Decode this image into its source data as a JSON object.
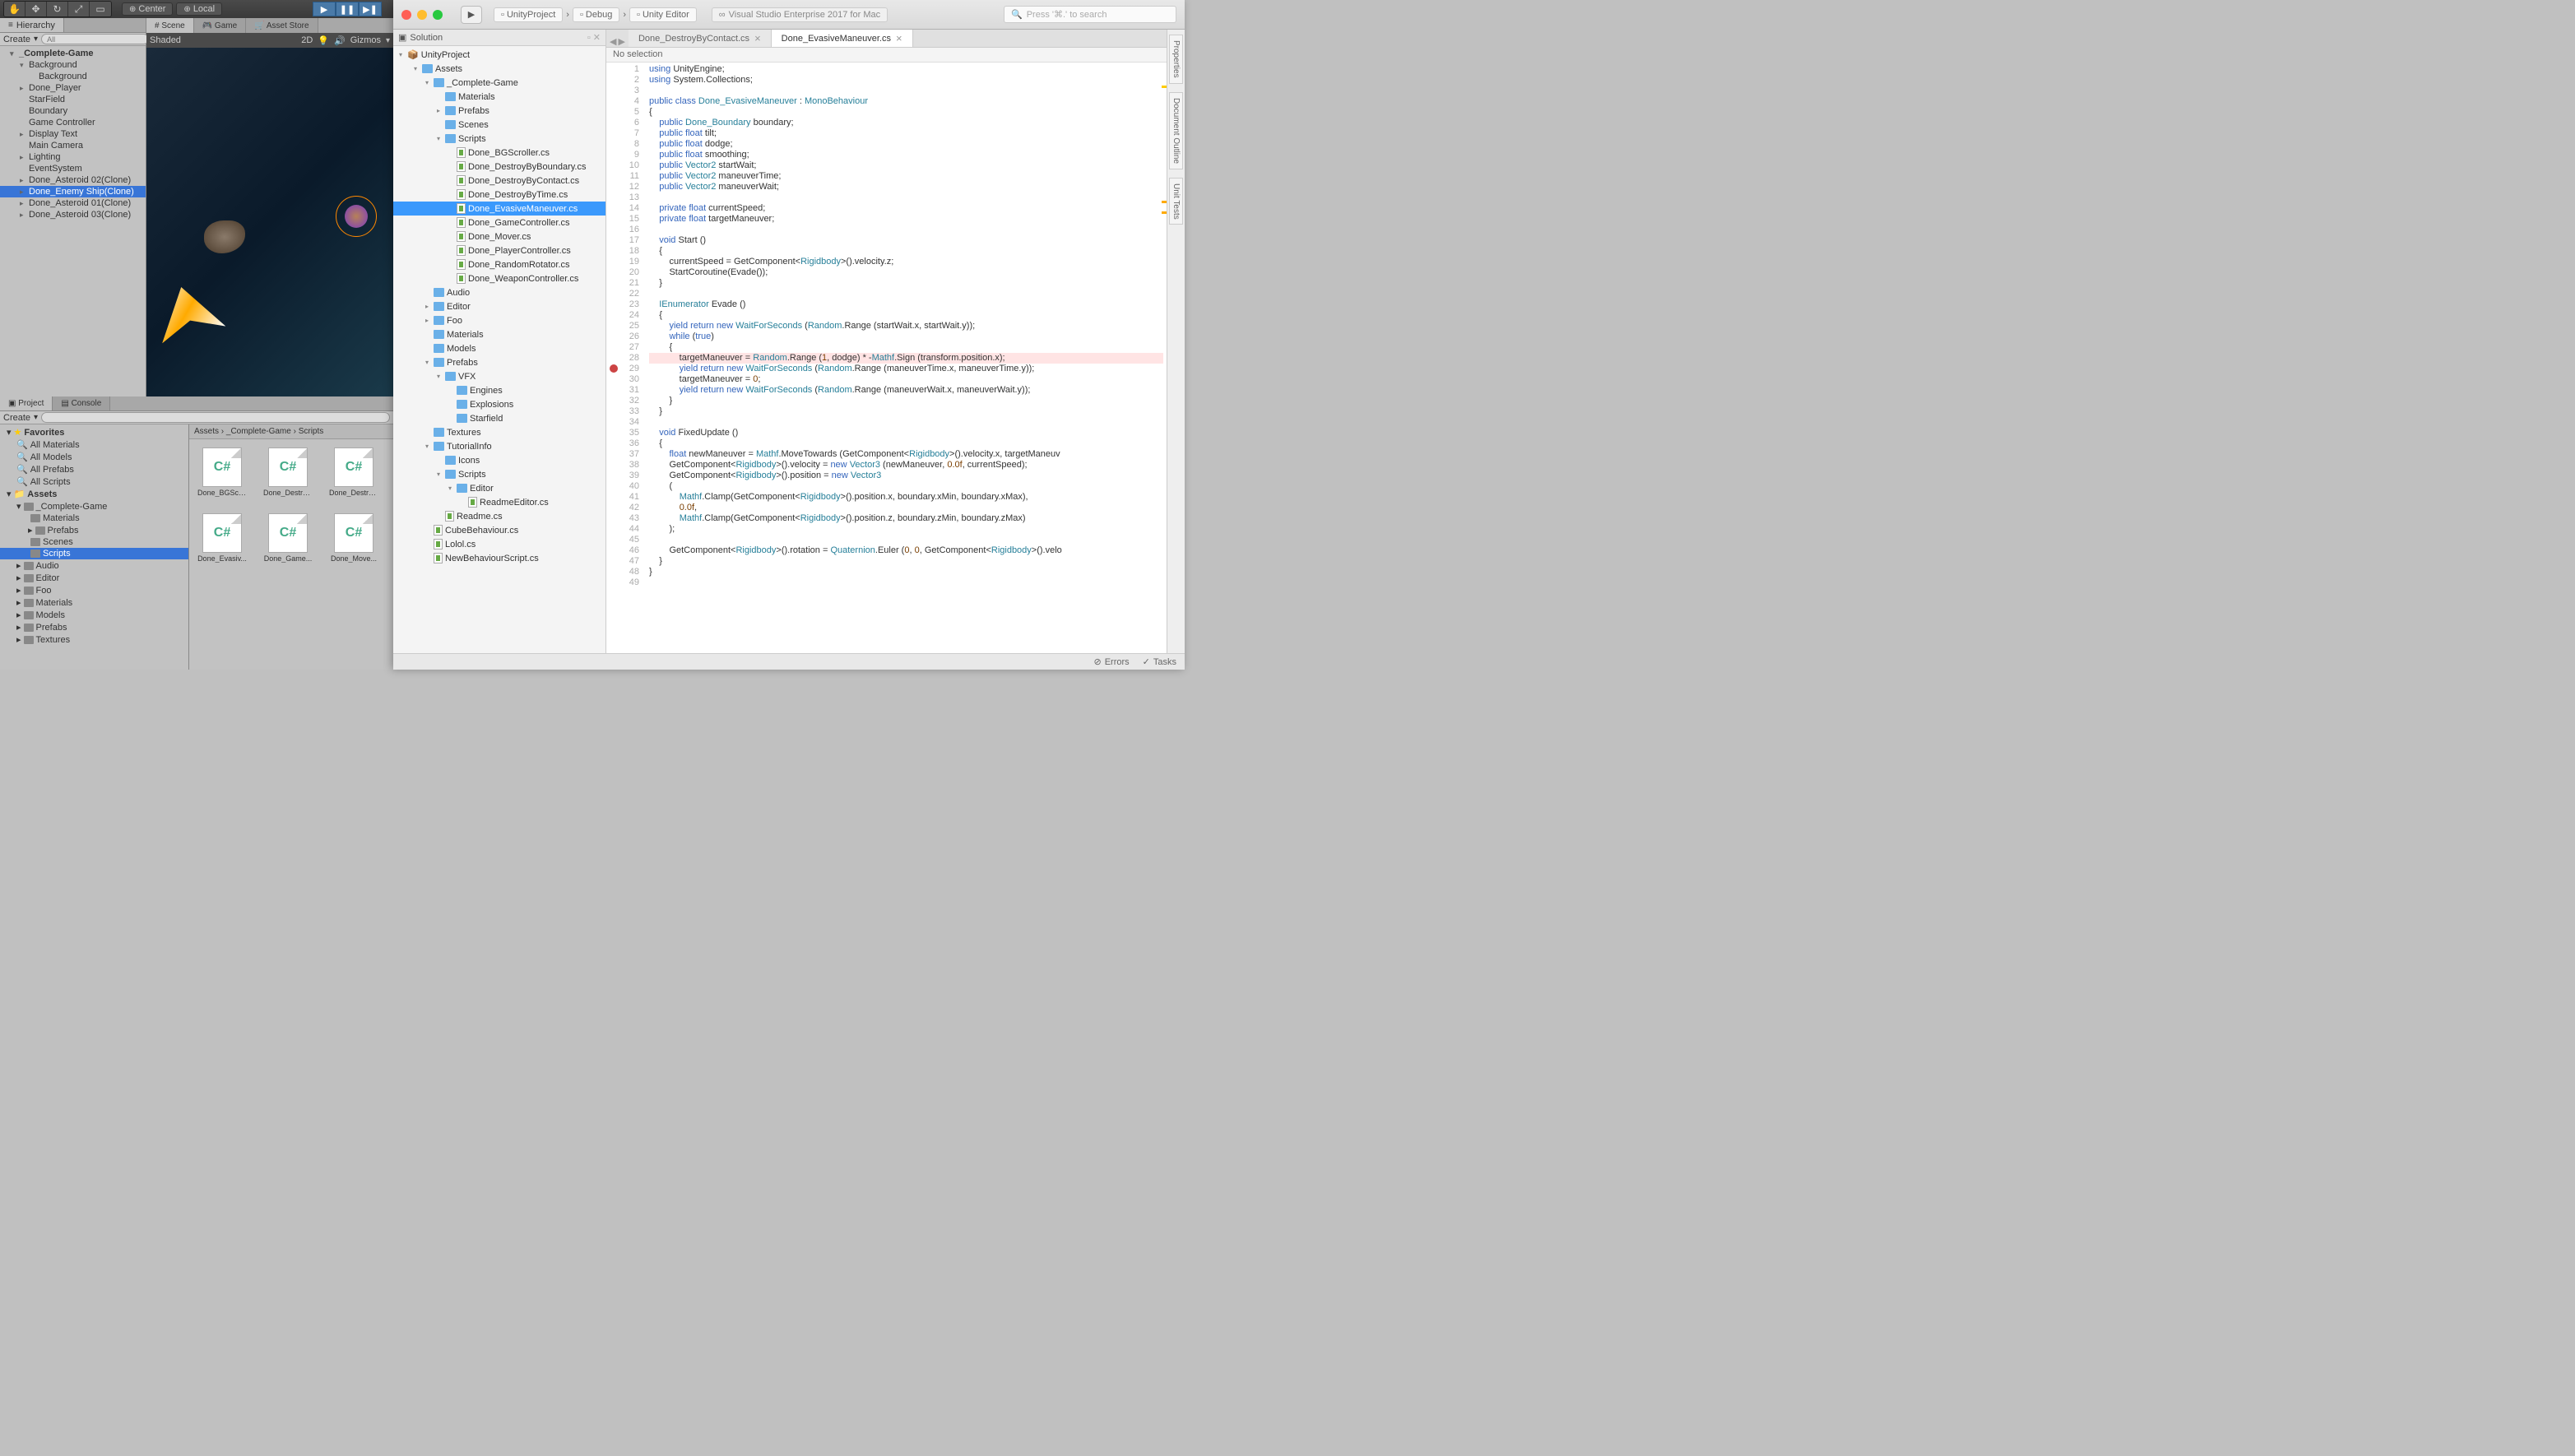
{
  "unity": {
    "toolbar": {
      "center": "Center",
      "local": "Local"
    },
    "hierarchy": {
      "title": "Hierarchy",
      "create": "Create",
      "search_ph": "All",
      "items": [
        {
          "label": "_Complete-Game",
          "bold": true,
          "arrow": "▾",
          "indent": 0
        },
        {
          "label": "Background",
          "arrow": "▾",
          "indent": 1
        },
        {
          "label": "Background",
          "indent": 2
        },
        {
          "label": "Done_Player",
          "arrow": "▸",
          "indent": 1
        },
        {
          "label": "StarField",
          "indent": 1
        },
        {
          "label": "Boundary",
          "indent": 1
        },
        {
          "label": "Game Controller",
          "indent": 1
        },
        {
          "label": "Display Text",
          "arrow": "▸",
          "indent": 1
        },
        {
          "label": "Main Camera",
          "indent": 1
        },
        {
          "label": "Lighting",
          "arrow": "▸",
          "indent": 1
        },
        {
          "label": "EventSystem",
          "indent": 1
        },
        {
          "label": "Done_Asteroid 02(Clone)",
          "arrow": "▸",
          "indent": 1
        },
        {
          "label": "Done_Enemy Ship(Clone)",
          "arrow": "▸",
          "indent": 1,
          "selected": true
        },
        {
          "label": "Done_Asteroid 01(Clone)",
          "arrow": "▸",
          "indent": 1
        },
        {
          "label": "Done_Asteroid 03(Clone)",
          "arrow": "▸",
          "indent": 1
        }
      ]
    },
    "scene": {
      "tabs": [
        "Scene",
        "Game",
        "Asset Store"
      ],
      "toolbar": {
        "shaded": "Shaded",
        "2d": "2D",
        "gizmos": "Gizmos"
      }
    },
    "project": {
      "tabs": [
        "Project",
        "Console"
      ],
      "create": "Create",
      "favorites": "Favorites",
      "fav_items": [
        "All Materials",
        "All Models",
        "All Prefabs",
        "All Scripts"
      ],
      "assets": "Assets",
      "tree": [
        {
          "label": "_Complete-Game",
          "arrow": "▾",
          "indent": 1
        },
        {
          "label": "Materials",
          "indent": 2
        },
        {
          "label": "Prefabs",
          "arrow": "▸",
          "indent": 2
        },
        {
          "label": "Scenes",
          "indent": 2
        },
        {
          "label": "Scripts",
          "indent": 2,
          "selected": true
        },
        {
          "label": "Audio",
          "arrow": "▸",
          "indent": 1
        },
        {
          "label": "Editor",
          "arrow": "▸",
          "indent": 1
        },
        {
          "label": "Foo",
          "arrow": "▸",
          "indent": 1
        },
        {
          "label": "Materials",
          "arrow": "▸",
          "indent": 1
        },
        {
          "label": "Models",
          "arrow": "▸",
          "indent": 1
        },
        {
          "label": "Prefabs",
          "arrow": "▸",
          "indent": 1
        },
        {
          "label": "Textures",
          "arrow": "▸",
          "indent": 1
        }
      ],
      "breadcrumb": [
        "Assets",
        "_Complete-Game",
        "Scripts"
      ],
      "grid": [
        "Done_BGScro...",
        "Done_Destro...",
        "Done_Destro...",
        "Done_Evasiv...",
        "Done_Game...",
        "Done_Move..."
      ]
    }
  },
  "vs": {
    "crumbs": [
      "UnityProject",
      "Debug",
      "Unity Editor"
    ],
    "badge": "Visual Studio Enterprise 2017 for Mac",
    "search_ph": "Press '⌘.' to search",
    "solution": {
      "title": "Solution",
      "root": "UnityProject",
      "tree": [
        {
          "l": "Assets",
          "d": 1,
          "a": "▾",
          "t": "folder"
        },
        {
          "l": "_Complete-Game",
          "d": 2,
          "a": "▾",
          "t": "folder"
        },
        {
          "l": "Materials",
          "d": 3,
          "t": "folder"
        },
        {
          "l": "Prefabs",
          "d": 3,
          "a": "▸",
          "t": "folder"
        },
        {
          "l": "Scenes",
          "d": 3,
          "t": "folder"
        },
        {
          "l": "Scripts",
          "d": 3,
          "a": "▾",
          "t": "folder"
        },
        {
          "l": "Done_BGScroller.cs",
          "d": 4,
          "t": "cs"
        },
        {
          "l": "Done_DestroyByBoundary.cs",
          "d": 4,
          "t": "cs"
        },
        {
          "l": "Done_DestroyByContact.cs",
          "d": 4,
          "t": "cs"
        },
        {
          "l": "Done_DestroyByTime.cs",
          "d": 4,
          "t": "cs"
        },
        {
          "l": "Done_EvasiveManeuver.cs",
          "d": 4,
          "t": "cs",
          "selected": true
        },
        {
          "l": "Done_GameController.cs",
          "d": 4,
          "t": "cs"
        },
        {
          "l": "Done_Mover.cs",
          "d": 4,
          "t": "cs"
        },
        {
          "l": "Done_PlayerController.cs",
          "d": 4,
          "t": "cs"
        },
        {
          "l": "Done_RandomRotator.cs",
          "d": 4,
          "t": "cs"
        },
        {
          "l": "Done_WeaponController.cs",
          "d": 4,
          "t": "cs"
        },
        {
          "l": "Audio",
          "d": 2,
          "t": "folder"
        },
        {
          "l": "Editor",
          "d": 2,
          "a": "▸",
          "t": "folder"
        },
        {
          "l": "Foo",
          "d": 2,
          "a": "▸",
          "t": "folder"
        },
        {
          "l": "Materials",
          "d": 2,
          "t": "folder"
        },
        {
          "l": "Models",
          "d": 2,
          "t": "folder"
        },
        {
          "l": "Prefabs",
          "d": 2,
          "a": "▾",
          "t": "folder"
        },
        {
          "l": "VFX",
          "d": 3,
          "a": "▾",
          "t": "folder"
        },
        {
          "l": "Engines",
          "d": 4,
          "t": "folder"
        },
        {
          "l": "Explosions",
          "d": 4,
          "t": "folder"
        },
        {
          "l": "Starfield",
          "d": 4,
          "t": "folder"
        },
        {
          "l": "Textures",
          "d": 2,
          "t": "folder"
        },
        {
          "l": "TutorialInfo",
          "d": 2,
          "a": "▾",
          "t": "folder"
        },
        {
          "l": "Icons",
          "d": 3,
          "t": "folder"
        },
        {
          "l": "Scripts",
          "d": 3,
          "a": "▾",
          "t": "folder"
        },
        {
          "l": "Editor",
          "d": 4,
          "a": "▾",
          "t": "folder"
        },
        {
          "l": "ReadmeEditor.cs",
          "d": 5,
          "t": "cs"
        },
        {
          "l": "Readme.cs",
          "d": 3,
          "t": "cs"
        },
        {
          "l": "CubeBehaviour.cs",
          "d": 2,
          "t": "cs"
        },
        {
          "l": "Lolol.cs",
          "d": 2,
          "t": "cs"
        },
        {
          "l": "NewBehaviourScript.cs",
          "d": 2,
          "t": "cs"
        }
      ]
    },
    "tabs": [
      {
        "label": "Done_DestroyByContact.cs"
      },
      {
        "label": "Done_EvasiveManeuver.cs",
        "active": true
      }
    ],
    "selection": "No selection",
    "rails": [
      "Properties",
      "Document Outline",
      "Unit Tests"
    ],
    "status": {
      "errors": "Errors",
      "tasks": "Tasks"
    },
    "code": [
      {
        "n": 1,
        "h": "<span class='kw'>using</span> UnityEngine;"
      },
      {
        "n": 2,
        "h": "<span class='kw'>using</span> System.Collections;"
      },
      {
        "n": 3,
        "h": ""
      },
      {
        "n": 4,
        "h": "<span class='kw'>public class</span> <span class='type'>Done_EvasiveManeuver</span> : <span class='type'>MonoBehaviour</span>"
      },
      {
        "n": 5,
        "h": "{"
      },
      {
        "n": 6,
        "h": "    <span class='kw'>public</span> <span class='type'>Done_Boundary</span> boundary;"
      },
      {
        "n": 7,
        "h": "    <span class='kw'>public</span> <span class='kw'>float</span> tilt;"
      },
      {
        "n": 8,
        "h": "    <span class='kw'>public</span> <span class='kw'>float</span> dodge;"
      },
      {
        "n": 9,
        "h": "    <span class='kw'>public</span> <span class='kw'>float</span> smoothing;"
      },
      {
        "n": 10,
        "h": "    <span class='kw'>public</span> <span class='type'>Vector2</span> startWait;"
      },
      {
        "n": 11,
        "h": "    <span class='kw'>public</span> <span class='type'>Vector2</span> maneuverTime;"
      },
      {
        "n": 12,
        "h": "    <span class='kw'>public</span> <span class='type'>Vector2</span> maneuverWait;"
      },
      {
        "n": 13,
        "h": ""
      },
      {
        "n": 14,
        "h": "    <span class='kw'>private</span> <span class='kw'>float</span> currentSpeed;"
      },
      {
        "n": 15,
        "h": "    <span class='kw'>private</span> <span class='kw'>float</span> targetManeuver;"
      },
      {
        "n": 16,
        "h": ""
      },
      {
        "n": 17,
        "h": "    <span class='kw'>void</span> Start ()"
      },
      {
        "n": 18,
        "h": "    {"
      },
      {
        "n": 19,
        "h": "        currentSpeed = GetComponent&lt;<span class='type'>Rigidbody</span>&gt;().velocity.z;"
      },
      {
        "n": 20,
        "h": "        StartCoroutine(Evade());"
      },
      {
        "n": 21,
        "h": "    }"
      },
      {
        "n": 22,
        "h": ""
      },
      {
        "n": 23,
        "h": "    <span class='type'>IEnumerator</span> Evade ()"
      },
      {
        "n": 24,
        "h": "    {"
      },
      {
        "n": 25,
        "h": "        <span class='kw'>yield return new</span> <span class='type'>WaitForSeconds</span> (<span class='type'>Random</span>.Range (startWait.x, startWait.y));"
      },
      {
        "n": 26,
        "h": "        <span class='kw'>while</span> (<span class='kw'>true</span>)"
      },
      {
        "n": 27,
        "h": "        {"
      },
      {
        "n": 28,
        "hl": true,
        "bp": true,
        "h": "            targetManeuver = <span class='type'>Random</span>.Range (<span class='num'>1</span>, dodge) * -<span class='type'>Mathf</span>.Sign (transform.position.x);"
      },
      {
        "n": 29,
        "h": "            <span class='kw'>yield return new</span> <span class='type'>WaitForSeconds</span> (<span class='type'>Random</span>.Range (maneuverTime.x, maneuverTime.y));"
      },
      {
        "n": 30,
        "h": "            targetManeuver = <span class='num'>0</span>;"
      },
      {
        "n": 31,
        "h": "            <span class='kw'>yield return new</span> <span class='type'>WaitForSeconds</span> (<span class='type'>Random</span>.Range (maneuverWait.x, maneuverWait.y));"
      },
      {
        "n": 32,
        "h": "        }"
      },
      {
        "n": 33,
        "h": "    }"
      },
      {
        "n": 34,
        "h": ""
      },
      {
        "n": 35,
        "h": "    <span class='kw'>void</span> FixedUpdate ()"
      },
      {
        "n": 36,
        "h": "    {"
      },
      {
        "n": 37,
        "h": "        <span class='kw'>float</span> newManeuver = <span class='type'>Mathf</span>.MoveTowards (GetComponent&lt;<span class='type'>Rigidbody</span>&gt;().velocity.x, targetManeuv"
      },
      {
        "n": 38,
        "h": "        GetComponent&lt;<span class='type'>Rigidbody</span>&gt;().velocity = <span class='kw'>new</span> <span class='type'>Vector3</span> (newManeuver, <span class='num'>0.0f</span>, currentSpeed);"
      },
      {
        "n": 39,
        "h": "        GetComponent&lt;<span class='type'>Rigidbody</span>&gt;().position = <span class='kw'>new</span> <span class='type'>Vector3</span>"
      },
      {
        "n": 40,
        "h": "        ("
      },
      {
        "n": 41,
        "h": "            <span class='type'>Mathf</span>.Clamp(GetComponent&lt;<span class='type'>Rigidbody</span>&gt;().position.x, boundary.xMin, boundary.xMax),"
      },
      {
        "n": 42,
        "h": "            <span class='num'>0.0f</span>,"
      },
      {
        "n": 43,
        "h": "            <span class='type'>Mathf</span>.Clamp(GetComponent&lt;<span class='type'>Rigidbody</span>&gt;().position.z, boundary.zMin, boundary.zMax)"
      },
      {
        "n": 44,
        "h": "        );"
      },
      {
        "n": 45,
        "h": ""
      },
      {
        "n": 46,
        "h": "        GetComponent&lt;<span class='type'>Rigidbody</span>&gt;().rotation = <span class='type'>Quaternion</span>.Euler (<span class='num'>0</span>, <span class='num'>0</span>, GetComponent&lt;<span class='type'>Rigidbody</span>&gt;().velo"
      },
      {
        "n": 47,
        "h": "    }"
      },
      {
        "n": 48,
        "h": "}"
      },
      {
        "n": 49,
        "h": ""
      }
    ]
  }
}
